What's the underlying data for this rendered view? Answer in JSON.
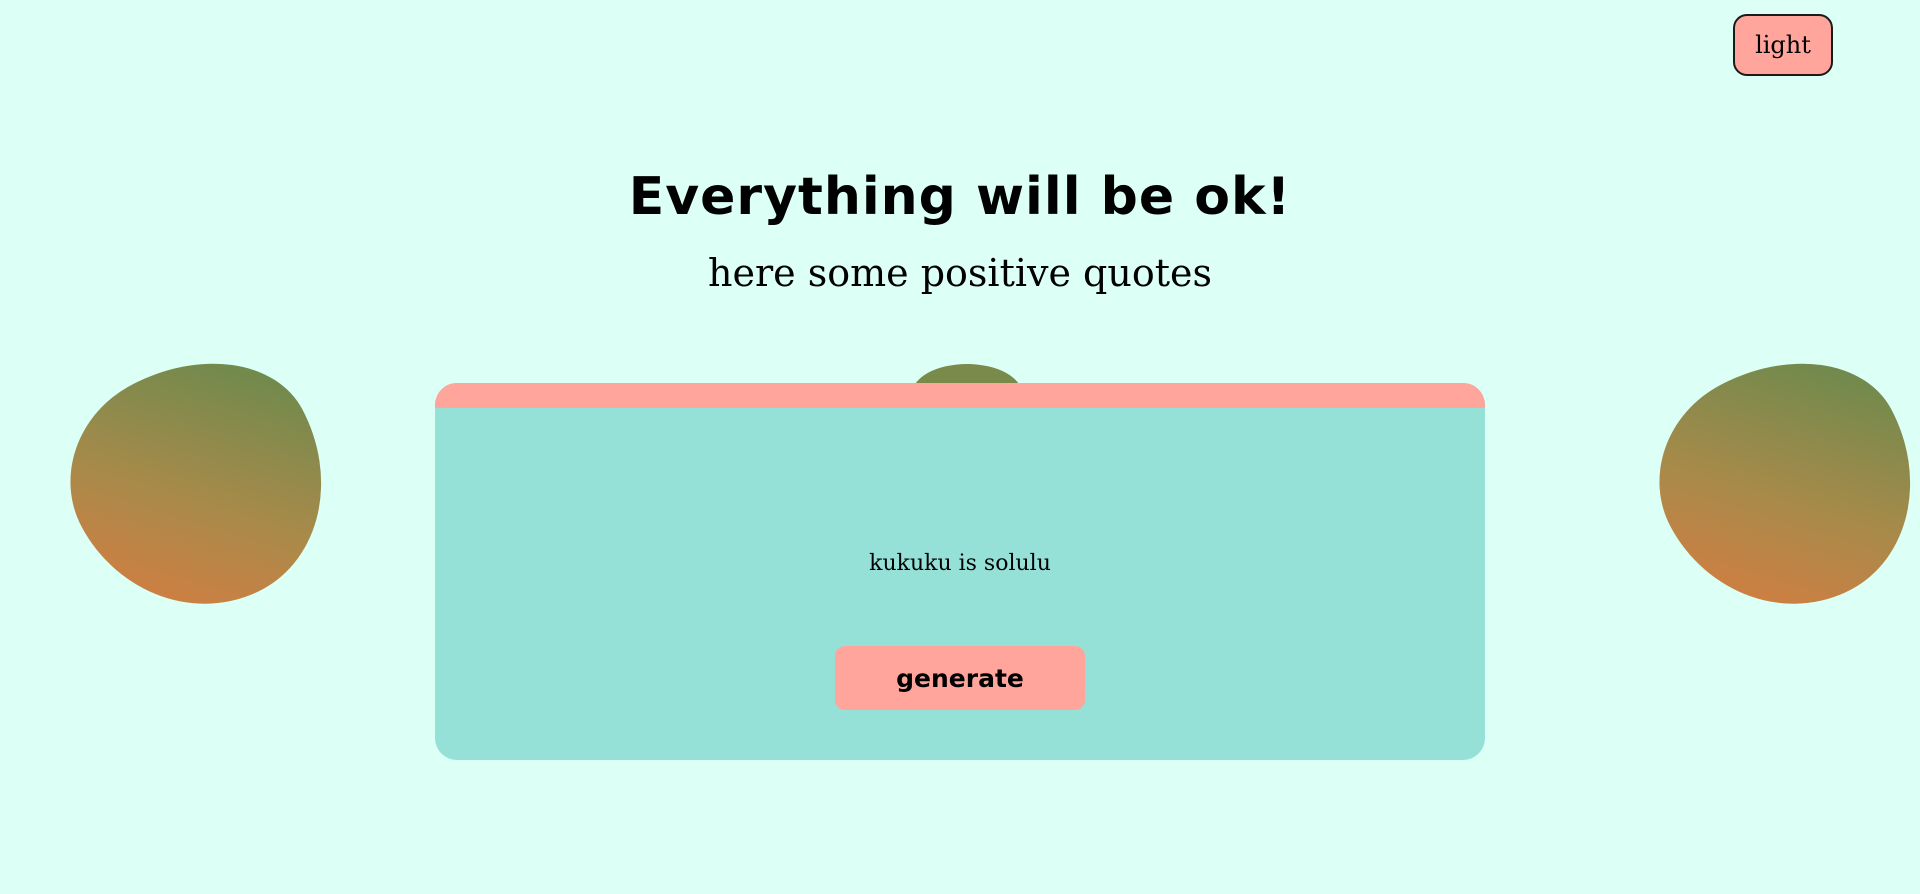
{
  "theme_toggle": {
    "label": "light"
  },
  "header": {
    "title": "Everything will be ok!",
    "subtitle": "here some positive quotes"
  },
  "quote_card": {
    "quote": "kukuku is solulu",
    "generate_label": "generate"
  },
  "colors": {
    "background": "#dcfff6",
    "card": "#95e1d8",
    "accent": "#ffa59c",
    "blob_orange": "#e07a3e",
    "blob_green": "#5d8a4e"
  }
}
